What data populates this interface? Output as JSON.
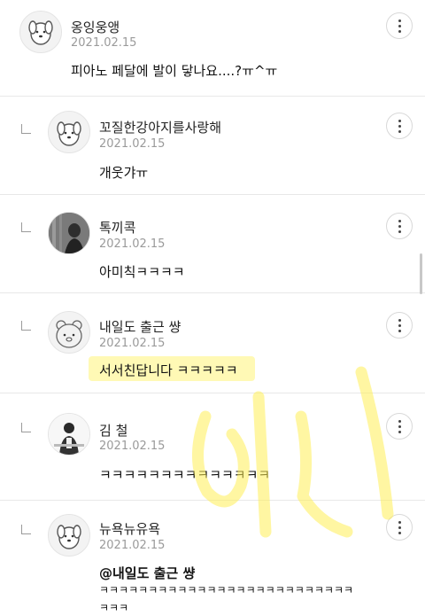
{
  "comments": [
    {
      "name": "옹잉웅앵",
      "date": "2021.02.15",
      "text": "피아노 페달에 발이 닿나요....?ㅠ^ㅠ"
    },
    {
      "name": "꼬질한강아지를사랑해",
      "date": "2021.02.15",
      "text": "개웃갸ㅠ"
    },
    {
      "name": "톡끼콕",
      "date": "2021.02.15",
      "text": "아미칙ㅋㅋㅋㅋ"
    },
    {
      "name": "내일도 출근 썅",
      "date": "2021.02.15",
      "text": "서서친답니다 ㅋㅋㅋㅋㅋ"
    },
    {
      "name": "김 철",
      "date": "2021.02.15",
      "text": "ㅋㅋㅋㅋㅋㅋㅋㅋㅋㅋㅋㅋㅋㅋ"
    },
    {
      "name": "뉴욕뉴유욕",
      "date": "2021.02.15",
      "mention": "@내일도 출근 썅",
      "text": "ㅋㅋㅋㅋㅋㅋㅋㅋㅋㅋㅋㅋㅋㅋㅋㅋㅋㅋㅋㅋㅋㅋㅋㅋㅋㅋ",
      "text_cont": "ㅋㅋㅋ"
    }
  ],
  "icons": {
    "more": "more-vertical-icon",
    "reply": "reply-indent-icon"
  },
  "colors": {
    "highlight": "#fff478",
    "watermark": "#ffee55"
  }
}
